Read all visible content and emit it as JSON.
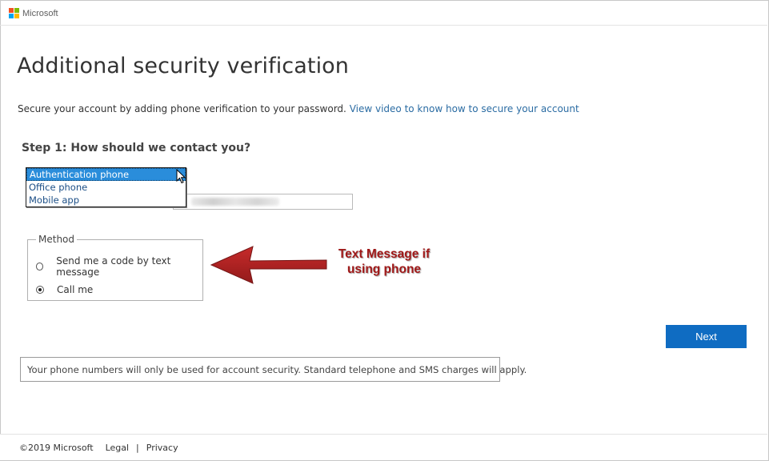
{
  "header": {
    "brand": "Microsoft",
    "logo_colors": [
      "#f25022",
      "#7fba00",
      "#00a4ef",
      "#ffb900"
    ]
  },
  "page": {
    "title": "Additional security verification",
    "subtitle": "Secure your account by adding phone verification to your password.",
    "video_link": "View video to know how to secure your account"
  },
  "step1": {
    "heading": "Step 1: How should we contact you?",
    "contact_options": [
      "Authentication phone",
      "Office phone",
      "Mobile app"
    ],
    "selected_option": "Authentication phone"
  },
  "method": {
    "legend": "Method",
    "options": [
      {
        "label": "Send me a code by text message",
        "checked": false
      },
      {
        "label": "Call me",
        "checked": true
      }
    ]
  },
  "annotation": {
    "line1": "Text Message if",
    "line2": "using phone",
    "color": "#a01818"
  },
  "actions": {
    "next_label": "Next",
    "accent_color": "#0f6cc2"
  },
  "notice": "Your phone numbers will only be used for account security. Standard telephone and SMS charges will apply.",
  "footer": {
    "copyright": "©2019 Microsoft",
    "legal": "Legal",
    "separator": "|",
    "privacy": "Privacy"
  }
}
